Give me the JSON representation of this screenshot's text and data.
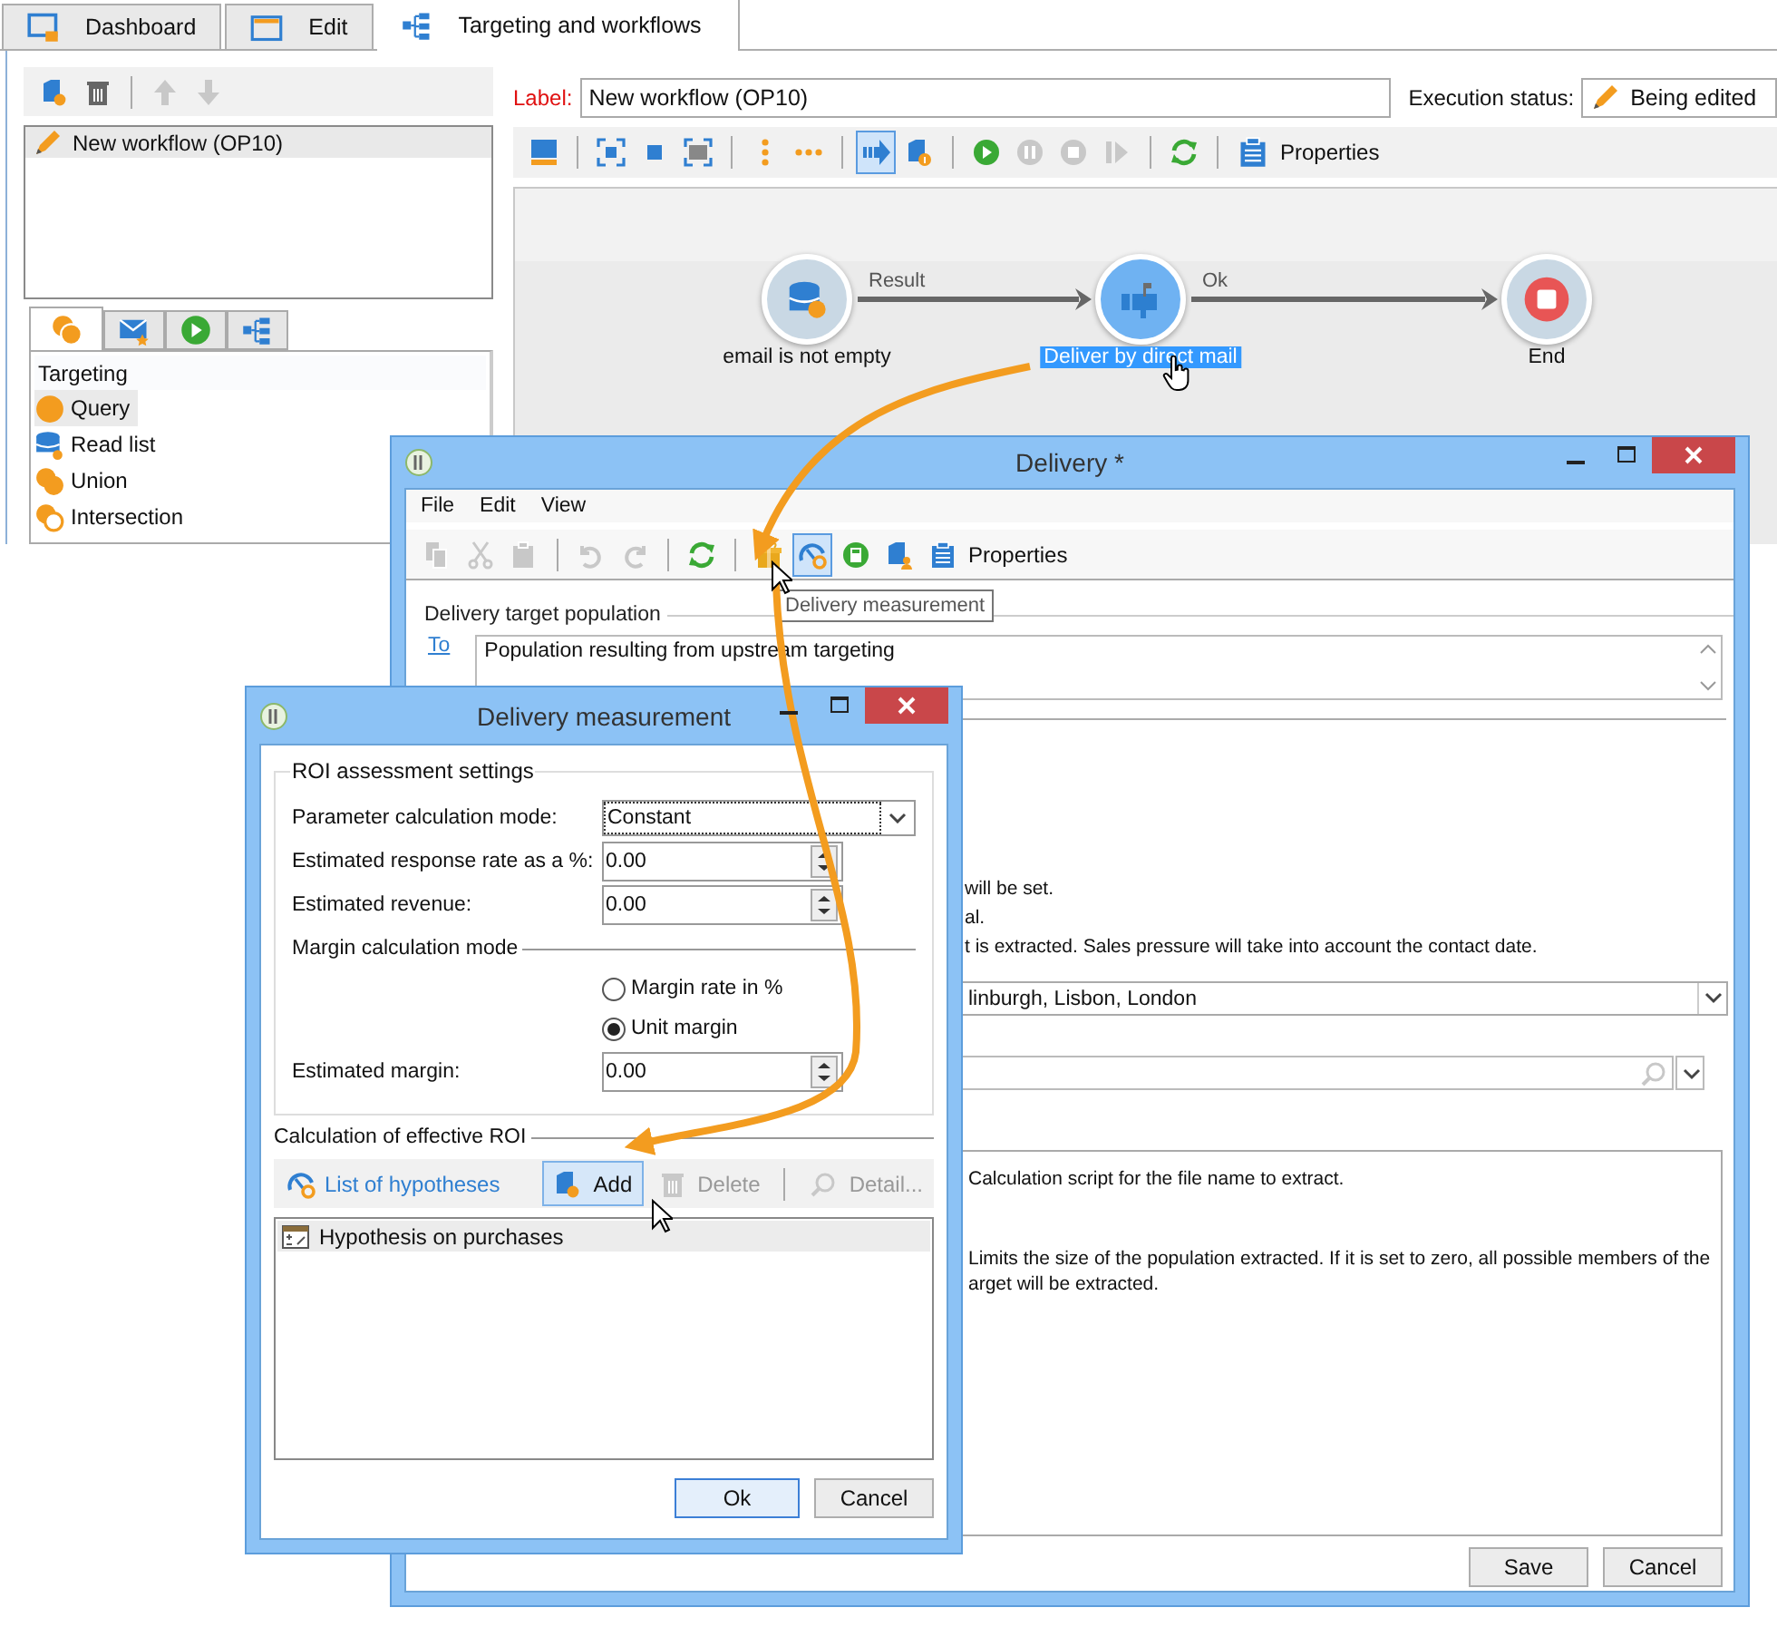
{
  "main_tabs": [
    {
      "label": "Dashboard",
      "kind": "dashboard",
      "selected": false
    },
    {
      "label": "Edit",
      "kind": "window",
      "selected": false
    },
    {
      "label": "Targeting and workflows",
      "kind": "workflow",
      "selected": true
    }
  ],
  "list_toolbar": [
    [
      {
        "kind": "newdoc",
        "disabled": false
      },
      {
        "kind": "trash",
        "disabled": false
      }
    ],
    [
      {
        "kind": "up",
        "disabled": true
      },
      {
        "kind": "down",
        "disabled": true
      }
    ]
  ],
  "workflow_list": [
    {
      "label": "New workflow (OP10)",
      "selected": true
    }
  ],
  "palette_tabs": [
    {
      "kind": "targeting",
      "selected": true
    },
    {
      "kind": "delivery",
      "selected": false
    },
    {
      "kind": "run",
      "selected": false
    },
    {
      "kind": "workflow",
      "selected": false
    }
  ],
  "palette": {
    "header": "Targeting",
    "items": [
      {
        "label": "Query",
        "kind": "query",
        "selected": true
      },
      {
        "label": "Read list",
        "kind": "readlist",
        "selected": false
      },
      {
        "label": "Union",
        "kind": "union",
        "selected": false
      },
      {
        "label": "Intersection",
        "kind": "intersection",
        "selected": false
      }
    ]
  },
  "label_field": {
    "label": "Label:",
    "value": "New workflow (OP10)"
  },
  "execution_status": {
    "label": "Execution status:",
    "value": "Being edited"
  },
  "workflow_toolbar": {
    "groups": [
      [
        {
          "kind": "panel",
          "active": false,
          "disabled": false
        }
      ],
      [
        {
          "kind": "fit",
          "active": false,
          "disabled": false
        },
        {
          "kind": "center",
          "active": false,
          "disabled": false
        },
        {
          "kind": "zoom",
          "active": false,
          "disabled": false
        }
      ],
      [
        {
          "kind": "vertical",
          "active": false,
          "disabled": false
        },
        {
          "kind": "horizontal",
          "active": false,
          "disabled": false
        }
      ],
      [
        {
          "kind": "flow",
          "active": true,
          "disabled": false
        },
        {
          "kind": "info",
          "active": false,
          "disabled": false
        }
      ],
      [
        {
          "kind": "start",
          "active": false,
          "disabled": false
        },
        {
          "kind": "pause",
          "active": false,
          "disabled": true
        },
        {
          "kind": "stop",
          "active": false,
          "disabled": true
        },
        {
          "kind": "step",
          "active": false,
          "disabled": true
        }
      ],
      [
        {
          "kind": "refresh",
          "active": false,
          "disabled": false
        }
      ]
    ],
    "properties": "Properties"
  },
  "canvas": {
    "nodes": [
      {
        "label": "email is not empty",
        "kind": "query",
        "selected": false
      },
      {
        "label": "Deliver by direct mail",
        "kind": "mail",
        "selected": true
      },
      {
        "label": "End",
        "kind": "end",
        "selected": false
      }
    ],
    "transitions": [
      "Result",
      "Ok"
    ]
  },
  "delivery": {
    "title": "Delivery *",
    "menu": [
      "File",
      "Edit",
      "View"
    ],
    "toolbar": [
      [
        {
          "kind": "copy",
          "active": false,
          "disabled": true
        },
        {
          "kind": "cut",
          "active": false,
          "disabled": true
        },
        {
          "kind": "paste",
          "active": false,
          "disabled": true
        }
      ],
      [
        {
          "kind": "undo",
          "active": false,
          "disabled": true
        },
        {
          "kind": "redo",
          "active": false,
          "disabled": true
        }
      ],
      [
        {
          "kind": "refresh",
          "active": false,
          "disabled": false
        }
      ],
      [
        {
          "kind": "gift",
          "active": false,
          "disabled": false
        },
        {
          "kind": "measure",
          "active": true,
          "disabled": false
        },
        {
          "kind": "calc",
          "active": false,
          "disabled": false
        },
        {
          "kind": "docuser",
          "active": false,
          "disabled": false
        }
      ]
    ],
    "properties": "Properties",
    "tooltip": "Delivery measurement",
    "target_section": "Delivery target population",
    "to_link": "To",
    "target_value": "Population resulting from upstream targeting",
    "partial_lines": [
      "will be set.",
      "al.",
      "t is extracted. Sales pressure will take into account the contact date."
    ],
    "dropdown_value": "linburgh, Lisbon, London",
    "description_lines": [
      "Calculation script for the file name to extract.",
      "Limits the size of the population extracted. If it is set to zero, all possible members of the",
      "arget will be extracted."
    ],
    "buttons": [
      "Save",
      "Cancel"
    ]
  },
  "measurement": {
    "title": "Delivery measurement",
    "roi_group": "ROI assessment settings",
    "fields": [
      {
        "label": "Parameter calculation mode:",
        "value": "Constant",
        "kind": "dropdown"
      },
      {
        "label": "Estimated response rate as a %:",
        "value": "0.00",
        "kind": "number"
      },
      {
        "label": "Estimated revenue:",
        "value": "0.00",
        "kind": "number"
      }
    ],
    "margin_heading": "Margin calculation mode",
    "radios": [
      {
        "label": "Margin rate in %",
        "selected": false
      },
      {
        "label": "Unit margin",
        "selected": true
      }
    ],
    "margin_field": {
      "label": "Estimated margin:",
      "value": "0.00"
    },
    "effective_heading": "Calculation of effective ROI",
    "list_title": "List of hypotheses",
    "actions": [
      {
        "label": "Add",
        "kind": "newdoc",
        "hover": true,
        "disabled": false
      },
      {
        "label": "Delete",
        "kind": "trash",
        "hover": false,
        "disabled": true
      },
      {
        "label": "Detail...",
        "kind": "search",
        "hover": false,
        "disabled": true
      }
    ],
    "hypotheses": [
      {
        "label": "Hypothesis on purchases",
        "selected": true
      }
    ],
    "buttons": [
      {
        "label": "Ok",
        "default": true
      },
      {
        "label": "Cancel",
        "default": false
      }
    ]
  }
}
